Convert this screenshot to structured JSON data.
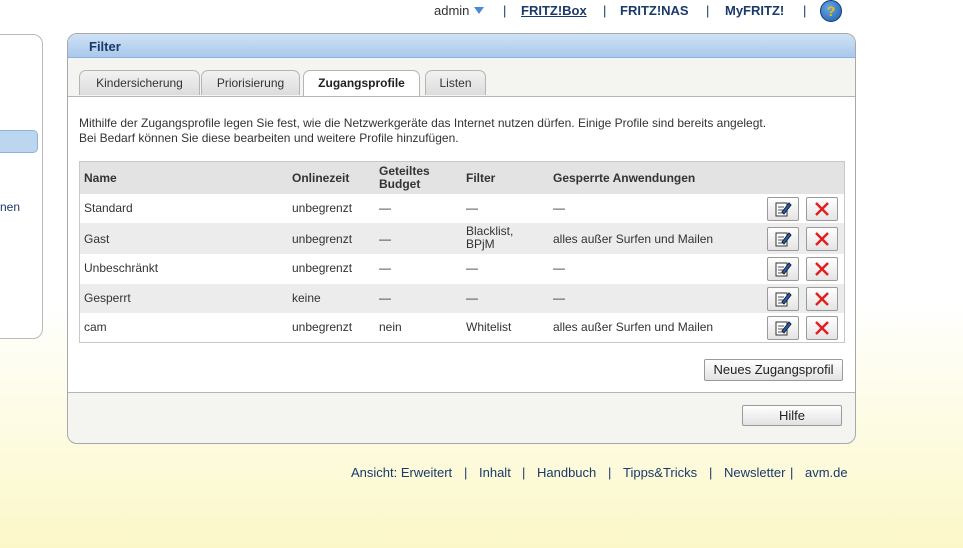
{
  "topbar": {
    "user": "admin",
    "links": [
      "FRITZ!Box",
      "FRITZ!NAS",
      "MyFRITZ!"
    ],
    "help_icon_glyph": "?"
  },
  "left_nav": {
    "partial_text": "nen"
  },
  "panel": {
    "title": "Filter",
    "tabs": [
      "Kindersicherung",
      "Priorisierung",
      "Zugangsprofile",
      "Listen"
    ],
    "active_tab": "Zugangsprofile",
    "intro_line1": "Mithilfe der Zugangsprofile legen Sie fest, wie die Netzwerkgeräte das Internet nutzen dürfen. Einige Profile sind bereits angelegt.",
    "intro_line2": "Bei Bedarf können Sie diese bearbeiten und weitere Profile hinzufügen."
  },
  "table": {
    "headers": {
      "name": "Name",
      "onlinezeit": "Onlinezeit",
      "budget_1": "Geteiltes",
      "budget_2": "Budget",
      "filter": "Filter",
      "anwendungen": "Gesperrte Anwendungen"
    },
    "rows": [
      {
        "name": "Standard",
        "onlinezeit": "unbegrenzt",
        "budget": "—",
        "filter": "—",
        "filter2": "",
        "anwendungen": "—"
      },
      {
        "name": "Gast",
        "onlinezeit": "unbegrenzt",
        "budget": "—",
        "filter": "Blacklist,",
        "filter2": "BPjM",
        "anwendungen": "alles außer Surfen und Mailen"
      },
      {
        "name": "Unbeschränkt",
        "onlinezeit": "unbegrenzt",
        "budget": "—",
        "filter": "—",
        "filter2": "",
        "anwendungen": "—"
      },
      {
        "name": "Gesperrt",
        "onlinezeit": "keine",
        "budget": "—",
        "filter": "—",
        "filter2": "",
        "anwendungen": "—"
      },
      {
        "name": "cam",
        "onlinezeit": "unbegrenzt",
        "budget": "nein",
        "filter": "Whitelist",
        "filter2": "",
        "anwendungen": "alles außer Surfen und Mailen"
      }
    ]
  },
  "buttons": {
    "new_profile": "Neues Zugangsprofil",
    "help": "Hilfe"
  },
  "footer": {
    "links": [
      "Ansicht: Erweitert",
      "Inhalt",
      "Handbuch",
      "Tipps&Tricks",
      "Newsletter",
      "avm.de"
    ]
  },
  "colors": {
    "accent": "#1a3a6a",
    "header_blue": "#a9c8eb",
    "delete_red": "#e02020"
  }
}
